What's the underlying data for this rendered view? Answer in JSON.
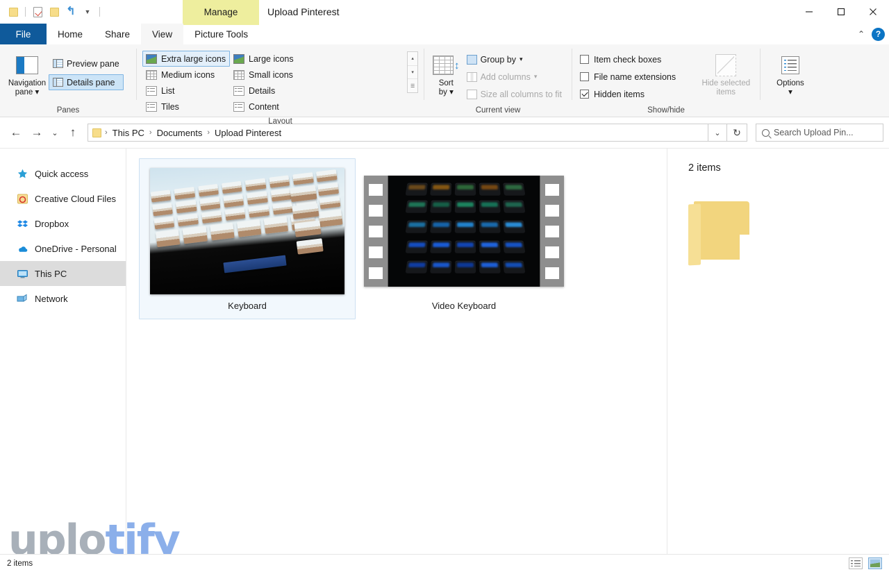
{
  "window": {
    "title": "Upload Pinterest",
    "contextual_tab_header": "Manage",
    "controls": {
      "minimize": "—",
      "maximize": "▢",
      "close": "✕",
      "collapse_ribbon": "⌃",
      "help": "?"
    }
  },
  "quick_access": {
    "items": [
      {
        "name": "folder-icon",
        "label": "Folder"
      },
      {
        "name": "properties-icon",
        "label": "Properties"
      },
      {
        "name": "new-folder-icon",
        "label": "New folder"
      },
      {
        "name": "undo-icon",
        "label": "Undo"
      },
      {
        "name": "customize-caret-icon",
        "label": "Customize Quick Access Toolbar"
      }
    ]
  },
  "tabs": [
    {
      "id": "file",
      "label": "File",
      "state": "file"
    },
    {
      "id": "home",
      "label": "Home",
      "state": "normal"
    },
    {
      "id": "share",
      "label": "Share",
      "state": "normal"
    },
    {
      "id": "view",
      "label": "View",
      "state": "active"
    },
    {
      "id": "picture-tools",
      "label": "Picture Tools",
      "state": "contextual"
    }
  ],
  "ribbon": {
    "groups": {
      "panes": {
        "label": "Panes",
        "navigation_pane": {
          "label_line1": "Navigation",
          "label_line2": "pane",
          "caret": "▾"
        },
        "preview_pane": {
          "label": "Preview pane",
          "checked": false
        },
        "details_pane": {
          "label": "Details pane",
          "checked": true
        }
      },
      "layout": {
        "label": "Layout",
        "items": [
          {
            "label": "Extra large icons",
            "selected": true,
            "icon": "photo-icon"
          },
          {
            "label": "Large icons",
            "selected": false,
            "icon": "photo-icon"
          },
          {
            "label": "Medium icons",
            "selected": false,
            "icon": "grid-icon"
          },
          {
            "label": "Small icons",
            "selected": false,
            "icon": "grid-icon"
          },
          {
            "label": "List",
            "selected": false,
            "icon": "list-icon"
          },
          {
            "label": "Details",
            "selected": false,
            "icon": "details-icon"
          },
          {
            "label": "Tiles",
            "selected": false,
            "icon": "tiles-icon"
          },
          {
            "label": "Content",
            "selected": false,
            "icon": "content-icon"
          }
        ],
        "scroll": {
          "up": "▴",
          "down": "▾",
          "more": "▾"
        }
      },
      "current_view": {
        "label": "Current view",
        "sort_by": {
          "label_line1": "Sort",
          "label_line2": "by",
          "caret": "▾"
        },
        "group_by": {
          "label": "Group by",
          "caret": "▾",
          "disabled": false
        },
        "add_columns": {
          "label": "Add columns",
          "caret": "▾",
          "disabled": true
        },
        "size_all_columns": {
          "label": "Size all columns to fit",
          "disabled": true
        }
      },
      "show_hide": {
        "label": "Show/hide",
        "item_check_boxes": {
          "label": "Item check boxes",
          "checked": false
        },
        "file_name_extensions": {
          "label": "File name extensions",
          "checked": false
        },
        "hidden_items": {
          "label": "Hidden items",
          "checked": true
        },
        "hide_selected": {
          "label_line1": "Hide selected",
          "label_line2": "items",
          "disabled": true
        }
      },
      "options": {
        "label": "Options",
        "caret": "▾"
      }
    }
  },
  "address_bar": {
    "back": "←",
    "forward": "→",
    "recent": "⌄",
    "up": "↑",
    "breadcrumbs": [
      "This PC",
      "Documents",
      "Upload Pinterest"
    ],
    "separator": "›",
    "dropdown": "⌄",
    "refresh": "↻"
  },
  "search": {
    "placeholder": "Search Upload Pin...",
    "icon": "search-icon"
  },
  "sidebar": {
    "items": [
      {
        "label": "Quick access",
        "icon": "star-icon",
        "selected": false
      },
      {
        "label": "Creative Cloud Files",
        "icon": "creative-cloud-icon",
        "selected": false
      },
      {
        "label": "Dropbox",
        "icon": "dropbox-icon",
        "selected": false
      },
      {
        "label": "OneDrive - Personal",
        "icon": "onedrive-icon",
        "selected": false
      },
      {
        "label": "This PC",
        "icon": "monitor-icon",
        "selected": true
      },
      {
        "label": "Network",
        "icon": "network-icon",
        "selected": false
      }
    ]
  },
  "files": [
    {
      "name": "Keyboard",
      "type": "image",
      "selected": true
    },
    {
      "name": "Video Keyboard",
      "type": "video",
      "selected": false
    }
  ],
  "details_pane": {
    "count_text": "2 items",
    "icon": "folder-icon"
  },
  "status_bar": {
    "count_text": "2 items",
    "views": [
      {
        "name": "details-view-button",
        "active": false
      },
      {
        "name": "large-icons-view-button",
        "active": true
      }
    ]
  },
  "watermark": {
    "part1": "uplo",
    "part2": "tify"
  },
  "colors": {
    "file_tab_blue": "#0f5a9b",
    "contextual_yellow": "#eeee9e",
    "selection_blue": "#cce4f7",
    "selection_border": "#7eb4e2",
    "sidebar_selected": "#dcdcdc",
    "folder_yellow": "#f2d57e"
  }
}
